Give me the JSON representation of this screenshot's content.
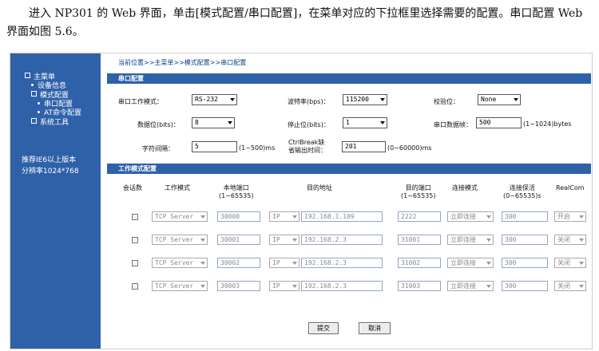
{
  "document": {
    "paragraph": "进入 NP301 的 Web 界面，单击[模式配置/串口配置]，在菜单对应的下拉框里选择需要的配置。串口配置 Web 界面如图 5.6。"
  },
  "sidebar": {
    "menu": [
      {
        "label": "主菜单",
        "level": 1,
        "marker": "box"
      },
      {
        "label": "设备信息",
        "level": 2,
        "marker": "dot"
      },
      {
        "label": "模式配置",
        "level": 2,
        "marker": "box"
      },
      {
        "label": "串口配置",
        "level": 3,
        "marker": "dot"
      },
      {
        "label": "AT命令配置",
        "level": 3,
        "marker": "dot"
      },
      {
        "label": "系统工具",
        "level": 2,
        "marker": "box"
      }
    ],
    "note_line1": "推荐IE6以上版本",
    "note_line2": "分辨率1024*768"
  },
  "breadcrumb": "当前位置>>主菜单>>模式配置>>串口配置",
  "serial": {
    "title": "串口配置",
    "work_mode_label": "串口工作模式：",
    "work_mode_value": "RS-232",
    "baud_label": "波特率(bps)：",
    "baud_value": "115200",
    "parity_label": "校验位：",
    "parity_value": "None",
    "databits_label": "数据位(bits)：",
    "databits_value": "8",
    "stopbits_label": "停止位(bits)：",
    "stopbits_value": "1",
    "frame_label": "串口数据帧：",
    "frame_value": "500",
    "frame_unit": "(1~1024)bytes",
    "char_interval_label": "字符间隔：",
    "char_interval_value": "5",
    "char_interval_unit": "(1~500)ms",
    "ctrlbreak_label_1": "CtrlBreak缺",
    "ctrlbreak_label_2": "省输出时间：",
    "ctrlbreak_value": "201",
    "ctrlbreak_unit": "(0~60000)ms"
  },
  "workmode": {
    "title": "工作模式配置",
    "headers": {
      "session": "会话数",
      "mode": "工作模式",
      "local_port_1": "本地端口",
      "local_port_2": "(1~65535)",
      "dest_addr": "目的地址",
      "dest_port_1": "目的端口",
      "dest_port_2": "(1~65535)",
      "conn_mode": "连接模式",
      "keepalive_1": "连接保活",
      "keepalive_2": "(0~65535)s",
      "realcom": "RealCom"
    },
    "rows": [
      {
        "mode": "TCP Server",
        "local_port": "30000",
        "addr_type": "IP",
        "addr": "192.168.1.109",
        "dest_port": "2222",
        "conn": "立即连接",
        "keepalive": "300",
        "realcom": "开启"
      },
      {
        "mode": "TCP Server",
        "local_port": "30001",
        "addr_type": "IP",
        "addr": "192.168.2.3",
        "dest_port": "31001",
        "conn": "立即连接",
        "keepalive": "300",
        "realcom": "关闭"
      },
      {
        "mode": "TCP Server",
        "local_port": "30002",
        "addr_type": "IP",
        "addr": "192.168.2.3",
        "dest_port": "31002",
        "conn": "立即连接",
        "keepalive": "300",
        "realcom": "关闭"
      },
      {
        "mode": "TCP Server",
        "local_port": "30003",
        "addr_type": "IP",
        "addr": "192.168.2.3",
        "dest_port": "31003",
        "conn": "立即连接",
        "keepalive": "300",
        "realcom": "关闭"
      }
    ]
  },
  "buttons": {
    "submit": "提交",
    "cancel": "取消"
  }
}
